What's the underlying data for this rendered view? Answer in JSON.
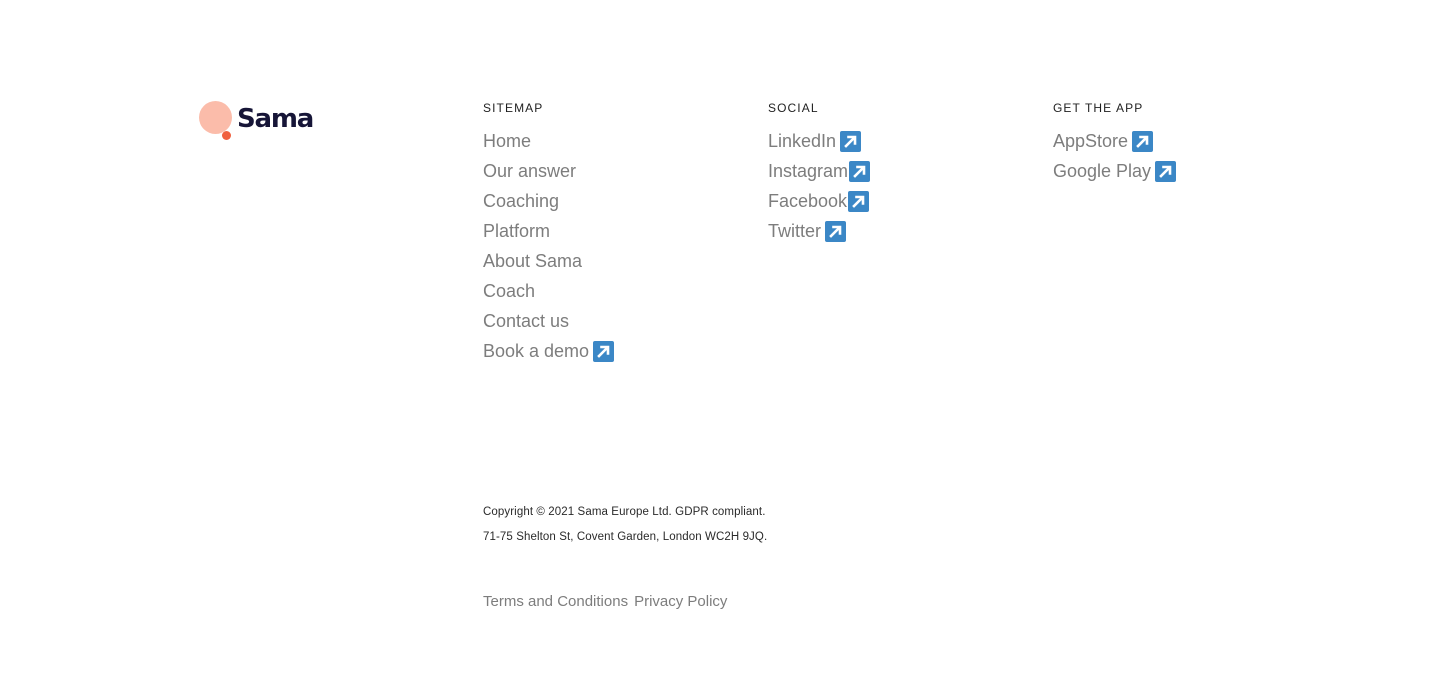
{
  "brand": {
    "name": "Sama",
    "colors": {
      "text": "#161537",
      "circle": "#fbbcaa",
      "dot": "#f0603f",
      "external_icon": "#3b87c6"
    }
  },
  "sitemap": {
    "heading": "SITEMAP",
    "items": [
      {
        "label": "Home"
      },
      {
        "label": "Our answer"
      },
      {
        "label": "Coaching"
      },
      {
        "label": "Platform"
      },
      {
        "label": "About Sama"
      },
      {
        "label": "Coach"
      },
      {
        "label": "Contact us"
      },
      {
        "label": "Book a demo",
        "icon": "external-link-icon"
      }
    ]
  },
  "social": {
    "heading": "SOCIAL",
    "items": [
      {
        "label": "LinkedIn",
        "icon": "external-link-icon"
      },
      {
        "label": "Instagram",
        "icon": "external-link-icon"
      },
      {
        "label": "Facebook",
        "icon": "external-link-icon"
      },
      {
        "label": "Twitter",
        "icon": "external-link-icon"
      }
    ]
  },
  "app": {
    "heading": "GET THE APP",
    "items": [
      {
        "label": "AppStore",
        "icon": "external-link-icon"
      },
      {
        "label": "Google Play",
        "icon": "external-link-icon"
      }
    ]
  },
  "legal": {
    "copyright": "Copyright © 2021 Sama Europe Ltd. GDPR compliant.",
    "address": "71-75 Shelton St, Covent Garden, London WC2H 9JQ."
  },
  "footer_links": [
    {
      "label": "Terms and Conditions"
    },
    {
      "label": "Privacy Policy"
    }
  ]
}
